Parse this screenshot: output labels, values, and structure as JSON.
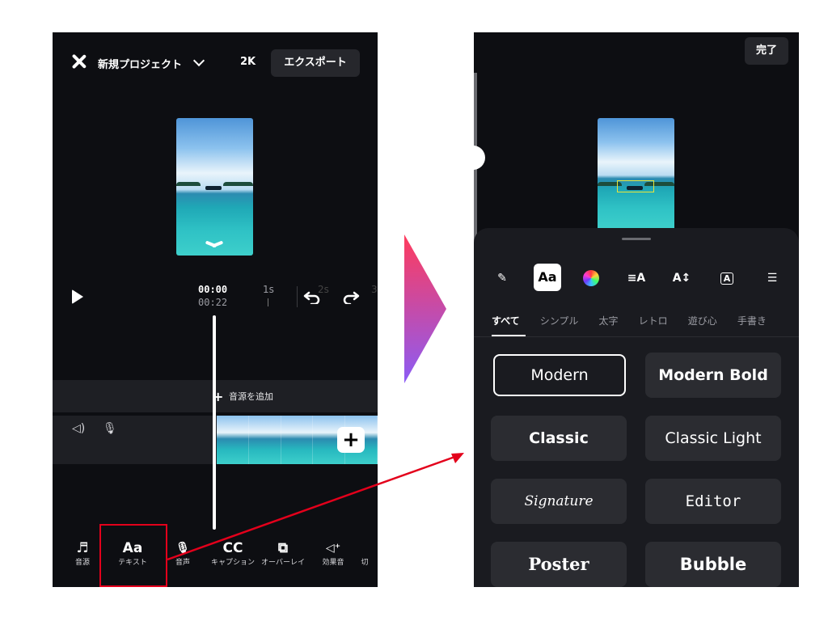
{
  "left_screen": {
    "close_icon": "close-icon",
    "project_title": "新規プロジェクト",
    "resolution": "2K",
    "export_label": "エクスポート",
    "time_current": "00:00",
    "time_total": "00:22",
    "ruler_ticks": [
      "1s",
      "2s",
      "3"
    ],
    "add_audio_label": "音源を追加",
    "toolbar": [
      {
        "icon": "♬",
        "label": "音源",
        "name": "music"
      },
      {
        "icon": "Aa",
        "label": "テキスト",
        "name": "text"
      },
      {
        "icon": "🎙",
        "label": "音声",
        "name": "voice"
      },
      {
        "icon": "CC",
        "label": "キャプション",
        "name": "caption"
      },
      {
        "icon": "⧉",
        "label": "オーバーレイ",
        "name": "overlay"
      },
      {
        "icon": "◁⁺",
        "label": "効果音",
        "name": "sound-effect"
      },
      {
        "icon": "",
        "label": "切",
        "name": "cut"
      }
    ]
  },
  "right_screen": {
    "done_label": "完了",
    "tool_icons": [
      {
        "name": "pen-icon",
        "glyph": "✎"
      },
      {
        "name": "font-icon",
        "glyph": "Aa",
        "active": true
      },
      {
        "name": "color-icon",
        "glyph": ""
      },
      {
        "name": "align-icon",
        "glyph": "≡A"
      },
      {
        "name": "size-icon",
        "glyph": "A↕"
      },
      {
        "name": "background-icon",
        "glyph": "A"
      },
      {
        "name": "filter-icon",
        "glyph": "☰"
      }
    ],
    "tabs": [
      "すべて",
      "シンプル",
      "太字",
      "レトロ",
      "遊び心",
      "手書き"
    ],
    "fonts": [
      "Modern",
      "Modern Bold",
      "Classic",
      "Classic Light",
      "Signature",
      "Editor",
      "Poster",
      "Bubble"
    ]
  },
  "colors": {
    "background": "#0d0e12",
    "highlight_box": "#e3001b",
    "arrow_gradient_start": "#ff3b5c",
    "arrow_gradient_end": "#8b5cf6"
  }
}
